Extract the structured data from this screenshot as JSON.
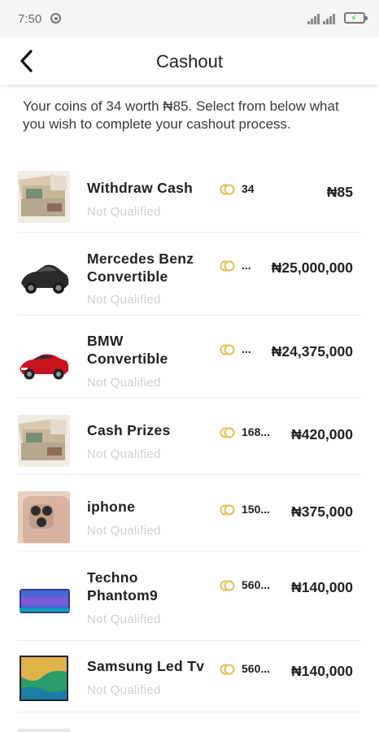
{
  "status_bar": {
    "time": "7:50"
  },
  "header": {
    "title": "Cashout"
  },
  "intro_text": "Your coins of 34 worth ₦85. Select from below what you wish to complete your cashout process.",
  "items": [
    {
      "name": "Withdraw Cash",
      "status": "Not Qualified",
      "coins": "34",
      "price": "₦85",
      "image": "cash-bundle"
    },
    {
      "name": "Mercedes Benz Convertible",
      "status": "Not Qualified",
      "coins": "...",
      "price": "₦25,000,000",
      "image": "black-car"
    },
    {
      "name": "BMW Convertible",
      "status": "Not Qualified",
      "coins": "...",
      "price": "₦24,375,000",
      "image": "red-car"
    },
    {
      "name": "Cash Prizes",
      "status": "Not Qualified",
      "coins": "168...",
      "price": "₦420,000",
      "image": "cash-bundle"
    },
    {
      "name": "iphone",
      "status": "Not Qualified",
      "coins": "150...",
      "price": "₦375,000",
      "image": "iphone"
    },
    {
      "name": "Techno Phantom9",
      "status": "Not Qualified",
      "coins": "560...",
      "price": "₦140,000",
      "image": "phone"
    },
    {
      "name": "Samsung Led Tv",
      "status": "Not Qualified",
      "coins": "560...",
      "price": "₦140,000",
      "image": "tv"
    }
  ],
  "colors": {
    "coin": "#e8c15a",
    "status_text": "#cfcfcf",
    "header_bg": "#ffffff",
    "status_bar_bg": "#f5f5f5"
  }
}
